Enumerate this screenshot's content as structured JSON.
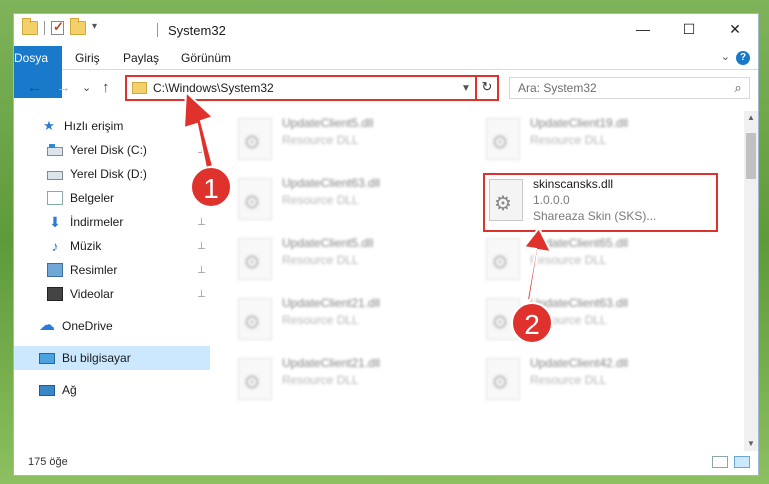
{
  "titlebar": {
    "title": "System32",
    "buttons": {
      "minimize": "—",
      "maximize": "☐",
      "close": "✕"
    }
  },
  "ribbon": {
    "tabs": [
      "Dosya",
      "Giriş",
      "Paylaş",
      "Görünüm"
    ],
    "help": "?"
  },
  "nav": {
    "back": "←",
    "forward": "→",
    "recent": "⌄",
    "up": "↑",
    "address": "C:\\Windows\\System32",
    "refresh": "↻",
    "search_placeholder": "Ara: System32",
    "search_icon": "⌕"
  },
  "sidebar": {
    "items": [
      {
        "label": "Hızlı erişim",
        "icon": "star-icon",
        "pinned": false
      },
      {
        "label": "Yerel Disk (C:)",
        "icon": "drive-icon",
        "pinned": true
      },
      {
        "label": "Yerel Disk (D:)",
        "icon": "drive-icon",
        "pinned": false
      },
      {
        "label": "Belgeler",
        "icon": "documents-icon",
        "pinned": true
      },
      {
        "label": "İndirmeler",
        "icon": "download-icon",
        "pinned": true
      },
      {
        "label": "Müzik",
        "icon": "music-icon",
        "pinned": true
      },
      {
        "label": "Resimler",
        "icon": "pictures-icon",
        "pinned": true
      },
      {
        "label": "Videolar",
        "icon": "videos-icon",
        "pinned": true
      },
      {
        "label": "OneDrive",
        "icon": "cloud-icon",
        "pinned": false
      },
      {
        "label": "Bu bilgisayar",
        "icon": "computer-icon",
        "pinned": false,
        "selected": true
      },
      {
        "label": "Ağ",
        "icon": "network-icon",
        "pinned": false
      }
    ],
    "pin_glyph": "📌"
  },
  "files": [
    {
      "name": "UpdateClient5.dll",
      "type": "Resource DLL",
      "blurred": true
    },
    {
      "name": "UpdateClient19.dll",
      "type": "Resource DLL",
      "blurred": true
    },
    {
      "name": "UpdateClient63.dll",
      "type": "Resource DLL",
      "blurred": true
    },
    {
      "name": "skinscansks.dll",
      "version": "1.0.0.0",
      "type": "Shareaza Skin (SKS)...",
      "blurred": false,
      "highlighted": true
    },
    {
      "name": "UpdateClient5.dll",
      "type": "Resource DLL",
      "blurred": true
    },
    {
      "name": "UpdateClient65.dll",
      "type": "Resource DLL",
      "blurred": true
    },
    {
      "name": "UpdateClient21.dll",
      "type": "Resource DLL",
      "blurred": true
    },
    {
      "name": "UpdateClient63.dll",
      "type": "Resource DLL",
      "blurred": true
    },
    {
      "name": "UpdateClient21.dll",
      "type": "Resource DLL",
      "blurred": true
    },
    {
      "name": "UpdateClient42.dll",
      "type": "Resource DLL",
      "blurred": true
    }
  ],
  "status": {
    "count": "175 öğe"
  },
  "callouts": {
    "one": "1",
    "two": "2"
  },
  "colors": {
    "accent": "#1979ca",
    "callout": "#e0322c",
    "selection": "#cce8ff"
  }
}
